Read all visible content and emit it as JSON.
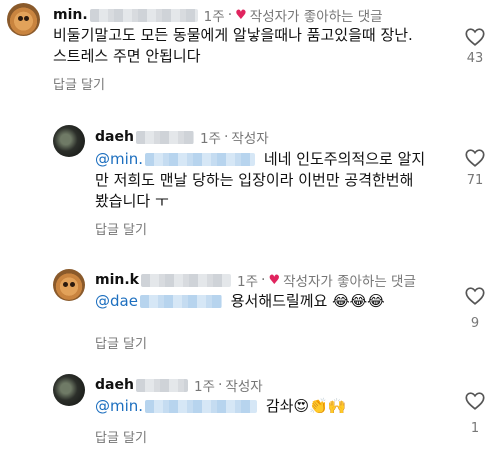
{
  "comments": [
    {
      "username": "min.",
      "time": "1주",
      "badge": "작성자가 좋아하는 댓글",
      "lines": [
        "비둘기말고도 모든 동물에게 알낳을때나 품고있을때 장난.",
        "스트레스 주면 안됩니다"
      ],
      "reply": "답글 달기",
      "likes": "43",
      "avatar": "dog-avatar"
    },
    {
      "username": "daeh",
      "time": "1주",
      "badge": "작성자",
      "mention": "@min.",
      "lines": [
        "네네 인도주의적으로 알지",
        "만 저희도 맨날 당하는 입장이라 이번만 공격한번해",
        "봤습니다 ㅜ"
      ],
      "reply": "답글 달기",
      "likes": "71",
      "avatar": "dark-avatar"
    },
    {
      "username": "min.k",
      "time": "1주",
      "badge": "작성자가 좋아하는 댓글",
      "mention": "@dae",
      "lines": [
        "용서해드릴께요 😂😂😂"
      ],
      "reply": "답글 달기",
      "likes": "9",
      "avatar": "dog-avatar"
    },
    {
      "username": "daeh",
      "time": "1주",
      "badge": "작성자",
      "mention": "@min.",
      "lines": [
        "감솨😍👏🙌"
      ],
      "reply": "답글 달기",
      "likes": "1",
      "avatar": "dark-avatar"
    }
  ],
  "colors": {
    "mention": "#1d6fbf",
    "heart": "#e0245e",
    "muted": "#777777"
  }
}
